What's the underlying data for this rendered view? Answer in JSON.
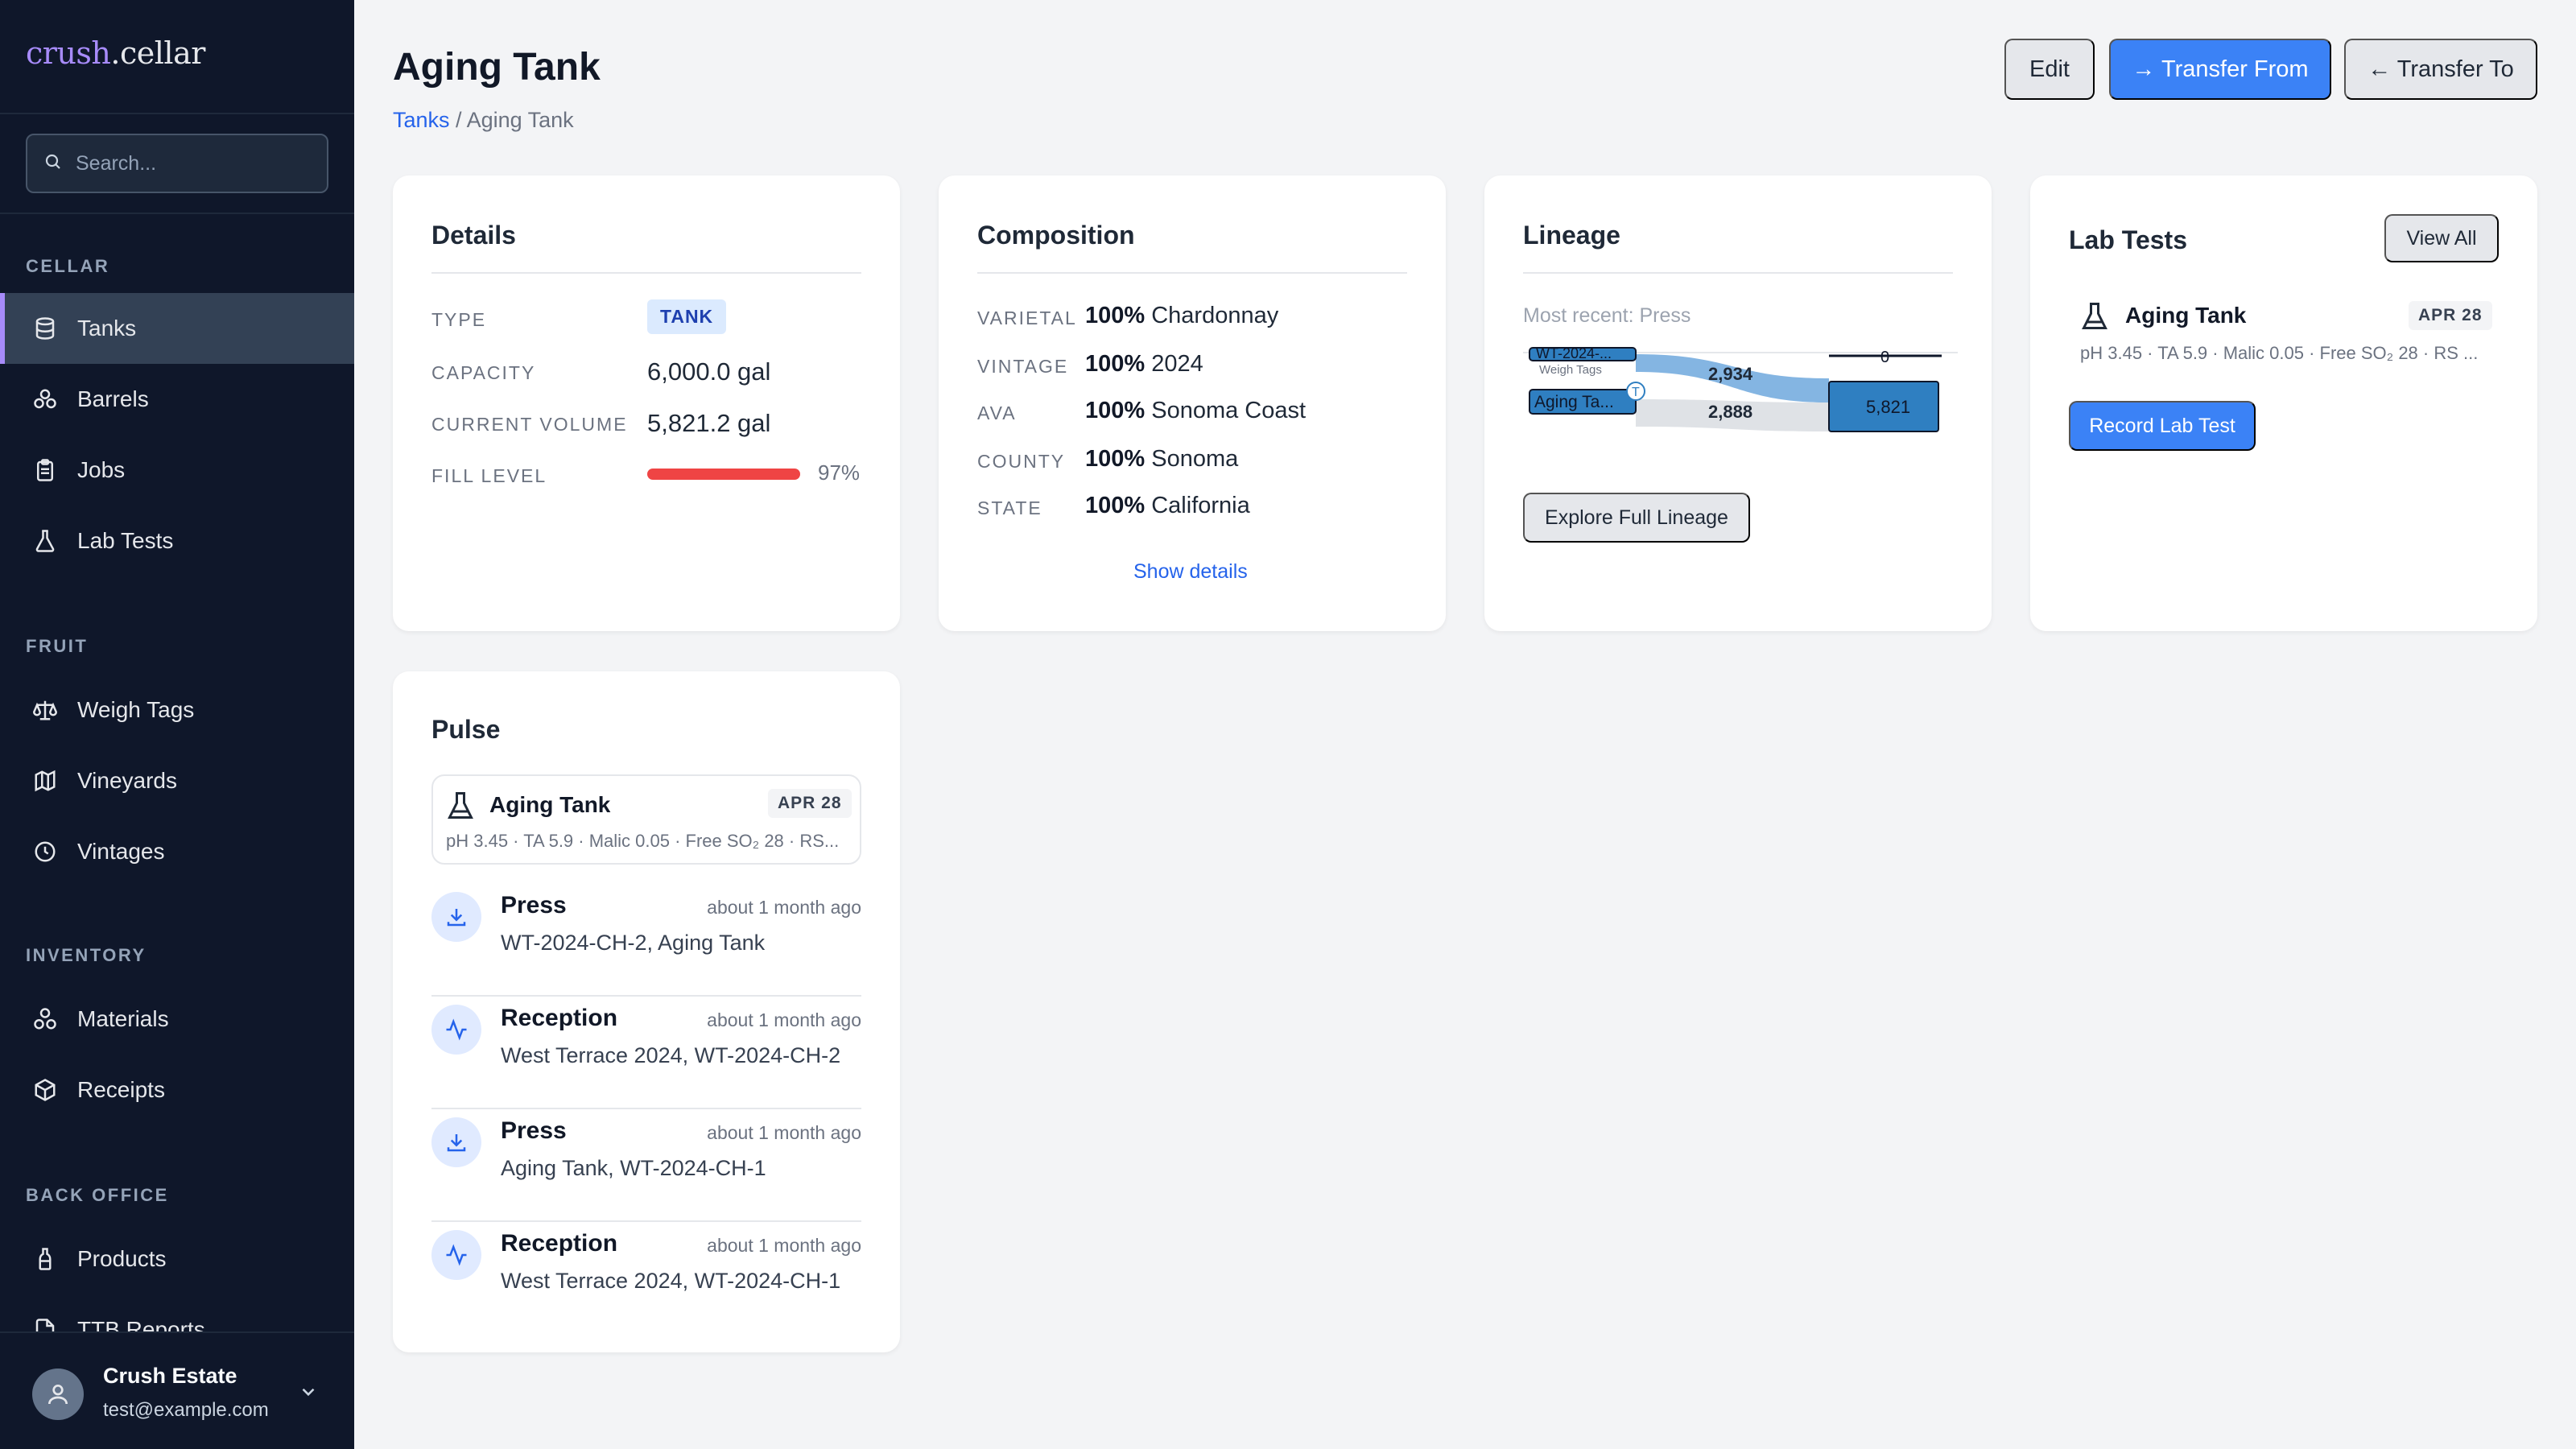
{
  "app": {
    "logo_part1": "crush",
    "logo_part2": ".cellar"
  },
  "sidebar": {
    "search_placeholder": "Search...",
    "sections": [
      {
        "label": "CELLAR"
      },
      {
        "label": "FRUIT"
      },
      {
        "label": "INVENTORY"
      },
      {
        "label": "BACK OFFICE"
      }
    ],
    "items": [
      {
        "label": "Tanks",
        "icon": "database-icon",
        "active": true
      },
      {
        "label": "Barrels",
        "icon": "barrels-icon"
      },
      {
        "label": "Jobs",
        "icon": "clipboard-icon"
      },
      {
        "label": "Lab Tests",
        "icon": "flask-icon"
      },
      {
        "label": "Weigh Tags",
        "icon": "scale-icon"
      },
      {
        "label": "Vineyards",
        "icon": "map-icon"
      },
      {
        "label": "Vintages",
        "icon": "clock-icon"
      },
      {
        "label": "Materials",
        "icon": "shapes-icon"
      },
      {
        "label": "Receipts",
        "icon": "package-icon"
      },
      {
        "label": "Products",
        "icon": "bottle-icon"
      },
      {
        "label": "TTB Reports",
        "icon": "file-icon"
      }
    ],
    "user": {
      "name": "Crush Estate",
      "email": "test@example.com"
    }
  },
  "header": {
    "title": "Aging Tank",
    "breadcrumb_link": "Tanks",
    "breadcrumb_sep": " / ",
    "breadcrumb_current": "Aging Tank",
    "edit_label": "Edit",
    "transfer_from_label": "→ Transfer From",
    "transfer_to_label": "← Transfer To"
  },
  "details": {
    "title": "Details",
    "type_label": "TYPE",
    "type_value": "TANK",
    "capacity_label": "CAPACITY",
    "capacity_value": "6,000.0 gal",
    "volume_label": "CURRENT VOLUME",
    "volume_value": "5,821.2 gal",
    "fill_label": "FILL LEVEL",
    "fill_pct_text": "97%",
    "fill_fraction": 0.97
  },
  "composition": {
    "title": "Composition",
    "rows": [
      {
        "label": "VARIETAL",
        "pct": "100%",
        "value": "Chardonnay"
      },
      {
        "label": "VINTAGE",
        "pct": "100%",
        "value": "2024"
      },
      {
        "label": "AVA",
        "pct": "100%",
        "value": "Sonoma Coast"
      },
      {
        "label": "COUNTY",
        "pct": "100%",
        "value": "Sonoma"
      },
      {
        "label": "STATE",
        "pct": "100%",
        "value": "California"
      }
    ],
    "show_details": "Show details"
  },
  "lineage": {
    "title": "Lineage",
    "most_recent": "Most recent: Press",
    "node_top": "WT-2024-...",
    "node_top_sub": "Weigh Tags",
    "node_bottom": "Aging Ta...",
    "flow_top_value": "2,934",
    "flow_bottom_value": "2,888",
    "right_top_value": "0",
    "right_node_value": "5,821",
    "explore_button": "Explore Full Lineage"
  },
  "lab_tests": {
    "title": "Lab Tests",
    "view_all": "View All",
    "entry_title": "Aging Tank",
    "entry_date": "APR 28",
    "entry_detail": "pH 3.45 · TA 5.9 · Malic 0.05 · Free SO₂ 28 · RS ...",
    "record_button": "Record Lab Test"
  },
  "pulse": {
    "title": "Pulse",
    "lab_entry": {
      "title": "Aging Tank",
      "date": "APR 28",
      "detail": "pH 3.45 · TA 5.9 · Malic 0.05 · Free SO₂ 28 · RS..."
    },
    "events": [
      {
        "title": "Press",
        "time": "about 1 month ago",
        "detail": "WT-2024-CH-2, Aging Tank",
        "icon": "download-icon"
      },
      {
        "title": "Reception",
        "time": "about 1 month ago",
        "detail": "West Terrace 2024, WT-2024-CH-2",
        "icon": "activity-icon"
      },
      {
        "title": "Press",
        "time": "about 1 month ago",
        "detail": "Aging Tank, WT-2024-CH-1",
        "icon": "download-icon"
      },
      {
        "title": "Reception",
        "time": "about 1 month ago",
        "detail": "West Terrace 2024, WT-2024-CH-1",
        "icon": "activity-icon"
      }
    ]
  }
}
